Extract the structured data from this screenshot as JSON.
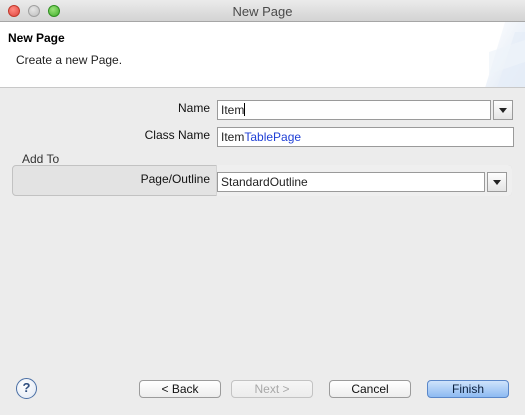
{
  "window": {
    "title": "New Page"
  },
  "header": {
    "title": "New Page",
    "description": "Create a new Page."
  },
  "form": {
    "name": {
      "label": "Name",
      "value": "Item"
    },
    "class_name": {
      "label": "Class Name",
      "value_prefix": "Item",
      "value_suffix": "TablePage"
    },
    "add_to": {
      "group_label": "Add To",
      "page_outline": {
        "label": "Page/Outline",
        "value": "StandardOutline"
      }
    }
  },
  "buttons": {
    "help": "?",
    "back": "< Back",
    "next": "Next >",
    "cancel": "Cancel",
    "finish": "Finish"
  },
  "colors": {
    "accent": "#1f3fd6",
    "default_button": "#8dbaf2"
  }
}
